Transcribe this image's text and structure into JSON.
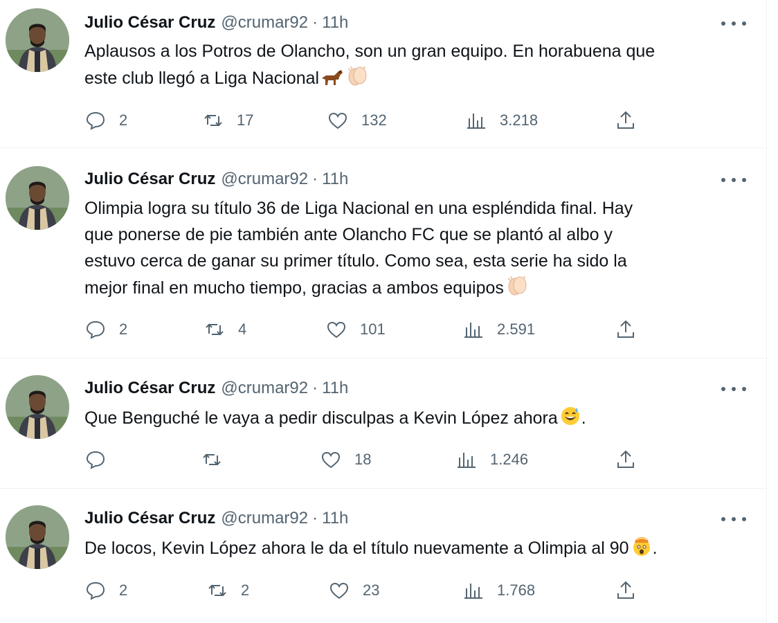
{
  "tweets": [
    {
      "name": "Julio César Cruz",
      "handle": "@crumar92",
      "separator": "·",
      "time": "11h",
      "lines": [
        "Aplausos a los Potros de Olancho, son un gran equipo. En horabuena que",
        "este club llegó a Liga Nacional"
      ],
      "emoji_after_last_line": [
        "horse-emoji",
        "clapping-hands-emoji"
      ],
      "trailing_text": "",
      "replies": "2",
      "reposts": "17",
      "likes": "132",
      "views": "3.218"
    },
    {
      "name": "Julio César Cruz",
      "handle": "@crumar92",
      "separator": "·",
      "time": "11h",
      "lines": [
        "Olimpia logra su título 36 de Liga Nacional en una espléndida final. Hay",
        "que ponerse de pie también ante Olancho FC que se plantó al albo y",
        "estuvo cerca de ganar su primer título. Como sea, esta serie ha sido la",
        "mejor final en mucho tiempo, gracias a ambos equipos"
      ],
      "emoji_after_last_line": [
        "clapping-hands-emoji"
      ],
      "trailing_text": "",
      "replies": "2",
      "reposts": "4",
      "likes": "101",
      "views": "2.591"
    },
    {
      "name": "Julio César Cruz",
      "handle": "@crumar92",
      "separator": "·",
      "time": "11h",
      "lines": [
        "Que Benguché le vaya a pedir disculpas a Kevin López ahora"
      ],
      "emoji_after_last_line": [
        "grinning-sweat-emoji"
      ],
      "trailing_text": ".",
      "replies": "",
      "reposts": "",
      "likes": "18",
      "views": "1.246"
    },
    {
      "name": "Julio César Cruz",
      "handle": "@crumar92",
      "separator": "·",
      "time": "11h",
      "lines": [
        "De locos, Kevin López ahora le da el título nuevamente a Olimpia al 90"
      ],
      "emoji_after_last_line": [
        "exploding-head-emoji"
      ],
      "trailing_text": ".",
      "replies": "2",
      "reposts": "2",
      "likes": "23",
      "views": "1.768"
    }
  ],
  "colors": {
    "text": "#0f1419",
    "secondary": "#536471",
    "divider": "#eff3f4"
  }
}
